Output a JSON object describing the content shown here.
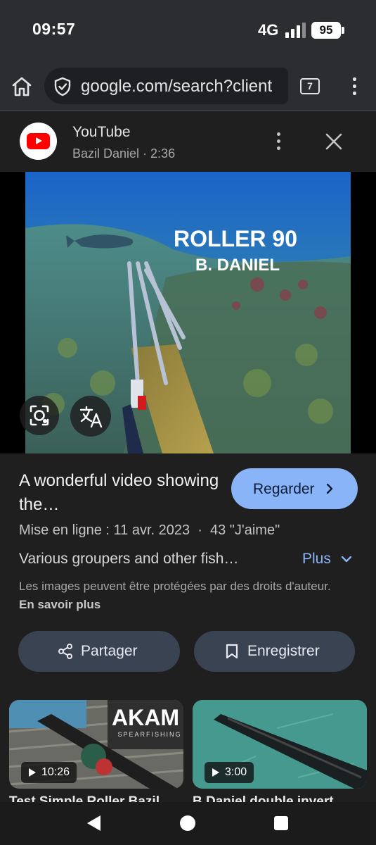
{
  "status_bar": {
    "time": "09:57",
    "network": "4G",
    "battery": "95"
  },
  "toolbar": {
    "url": "google.com/search?client",
    "tab_count": "7"
  },
  "source": {
    "name": "YouTube",
    "meta": "Bazil Daniel · 2:36"
  },
  "media": {
    "overlay_line1": "ROLLER 90",
    "overlay_line2": "B. DANIEL"
  },
  "info": {
    "title": "A wonderful video showing the…",
    "watch_label": "Regarder",
    "upload_line": "Mise en ligne : 11 avr. 2023  ·  43 \"J'aime\"",
    "description": "Various groupers and other fish…",
    "more_label": "Plus",
    "copyright_text": "Les images peuvent être protégées par des droits d'auteur.",
    "copyright_link": "En savoir plus"
  },
  "actions": {
    "share_label": "Partager",
    "save_label": "Enregistrer"
  },
  "related": [
    {
      "duration": "10:26",
      "title": "Test Simple Roller Bazil",
      "watermark": "AKAM",
      "watermark_sub": "SPEARFISHING"
    },
    {
      "duration": "3:00",
      "title": "B Daniel double invert"
    }
  ],
  "colors": {
    "accent": "#8ab4f8",
    "button_bg": "#3a4352",
    "youtube_red": "#ff0000",
    "background": "#1f1f1f"
  }
}
